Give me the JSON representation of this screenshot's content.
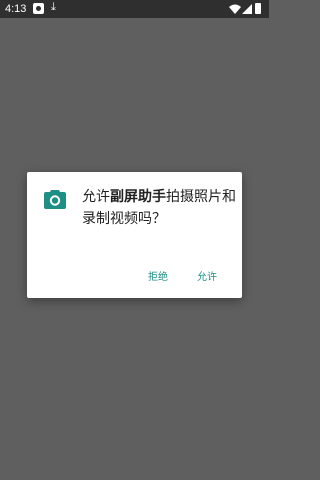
{
  "status_bar": {
    "time": "4:13",
    "icons": [
      "notification-icon",
      "download-icon",
      "wifi-icon",
      "signal-icon",
      "battery-icon"
    ]
  },
  "dialog": {
    "icon": "camera-icon",
    "message_prefix": "允许",
    "app_name": "副屏助手",
    "message_suffix": "拍摄照片和录制视频吗？",
    "deny_label": "拒绝",
    "allow_label": "允许",
    "accent_color": "#1f8e85"
  }
}
